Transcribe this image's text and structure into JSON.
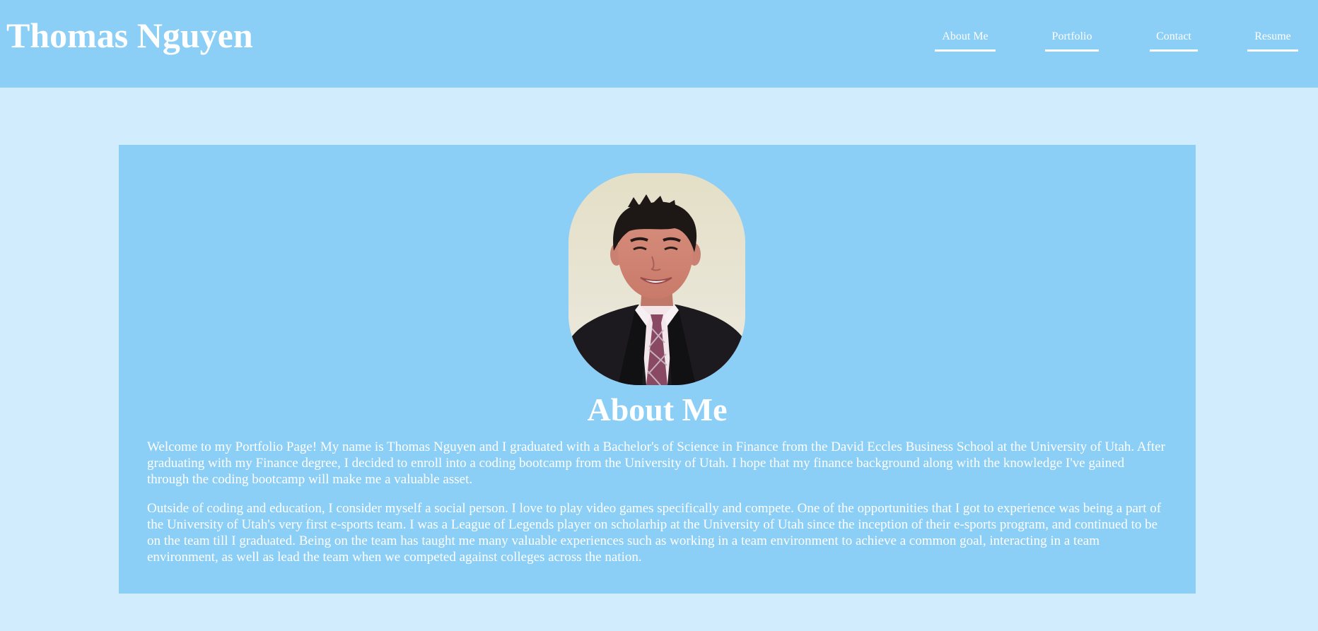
{
  "header": {
    "title": "Thomas Nguyen",
    "nav": [
      {
        "label": "About Me"
      },
      {
        "label": "Portfolio"
      },
      {
        "label": "Contact"
      },
      {
        "label": "Resume"
      }
    ]
  },
  "about": {
    "heading": "About Me",
    "photo_alt": "Portrait of Thomas Nguyen",
    "paragraphs": [
      "Welcome to my Portfolio Page! My name is Thomas Nguyen and I graduated with a Bachelor's of Science in Finance from the David Eccles Business School at the University of Utah. After graduating with my Finance degree, I decided to enroll into a coding bootcamp from the University of Utah. I hope that my finance background along with the knowledge I've gained through the coding bootcamp will make me a valuable asset.",
      "Outside of coding and education, I consider myself a social person. I love to play video games specifically and compete. One of the opportunities that I got to experience was being a part of the University of Utah's very first e-sports team. I was a League of Legends player on scholarhip at the University of Utah since the inception of their e-sports program, and continued to be on the team till I graduated. Being on the team has taught me many valuable experiences such as working in a team environment to achieve a common goal, interacting in a team environment, as well as lead the team when we competed against colleges across the nation."
    ]
  },
  "colors": {
    "page_background": "#d1edfd",
    "header_background": "#8bcef6",
    "card_background": "#8bcef6",
    "text": "#ffffff"
  }
}
